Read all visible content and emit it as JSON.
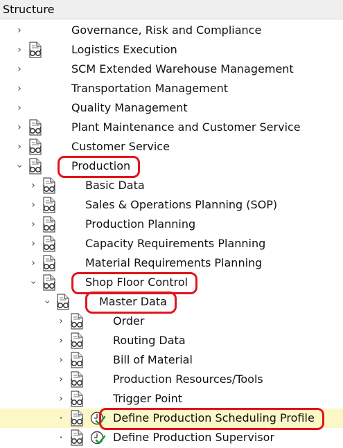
{
  "header": {
    "title": "Structure"
  },
  "tree": [
    {
      "label": "Governance, Risk and Compliance",
      "level": 0,
      "expander": "collapsed",
      "icon": "none"
    },
    {
      "label": "Logistics Execution",
      "level": 0,
      "expander": "collapsed",
      "icon": "documentation-glasses-icon"
    },
    {
      "label": "SCM Extended Warehouse Management",
      "level": 0,
      "expander": "collapsed",
      "icon": "none"
    },
    {
      "label": "Transportation Management",
      "level": 0,
      "expander": "collapsed",
      "icon": "none"
    },
    {
      "label": "Quality Management",
      "level": 0,
      "expander": "collapsed",
      "icon": "none"
    },
    {
      "label": "Plant Maintenance and Customer Service",
      "level": 0,
      "expander": "collapsed",
      "icon": "documentation-glasses-icon"
    },
    {
      "label": "Customer Service",
      "level": 0,
      "expander": "collapsed",
      "icon": "documentation-glasses-icon"
    },
    {
      "label": "Production",
      "level": 0,
      "expander": "expanded",
      "icon": "documentation-glasses-icon",
      "marked": true
    },
    {
      "label": "Basic Data",
      "level": 1,
      "expander": "collapsed",
      "icon": "documentation-glasses-icon"
    },
    {
      "label": "Sales & Operations Planning (SOP)",
      "level": 1,
      "expander": "collapsed",
      "icon": "documentation-glasses-icon"
    },
    {
      "label": "Production Planning",
      "level": 1,
      "expander": "collapsed",
      "icon": "documentation-glasses-icon"
    },
    {
      "label": "Capacity Requirements Planning",
      "level": 1,
      "expander": "collapsed",
      "icon": "documentation-glasses-icon"
    },
    {
      "label": "Material Requirements Planning",
      "level": 1,
      "expander": "collapsed",
      "icon": "documentation-glasses-icon"
    },
    {
      "label": "Shop Floor Control",
      "level": 1,
      "expander": "expanded",
      "icon": "documentation-glasses-icon",
      "marked": true
    },
    {
      "label": "Master Data",
      "level": 2,
      "expander": "expanded",
      "icon": "documentation-glasses-icon",
      "marked": true
    },
    {
      "label": "Order",
      "level": 3,
      "expander": "collapsed",
      "icon": "documentation-glasses-icon"
    },
    {
      "label": "Routing Data",
      "level": 3,
      "expander": "collapsed",
      "icon": "documentation-glasses-icon"
    },
    {
      "label": "Bill of Material",
      "level": 3,
      "expander": "collapsed",
      "icon": "documentation-glasses-icon"
    },
    {
      "label": "Production Resources/Tools",
      "level": 3,
      "expander": "collapsed",
      "icon": "documentation-glasses-icon"
    },
    {
      "label": "Trigger Point",
      "level": 3,
      "expander": "collapsed",
      "icon": "documentation-glasses-icon"
    },
    {
      "label": "Define Production Scheduling Profile",
      "level": 3,
      "expander": "leaf",
      "icon": "documentation-glasses-icon",
      "activity_icon": "execute-clock-check-icon",
      "highlighted": true,
      "marked": true
    },
    {
      "label": "Define Production Supervisor",
      "level": 3,
      "expander": "leaf",
      "icon": "documentation-glasses-icon",
      "activity_icon": "execute-clock-check-icon"
    }
  ],
  "colors": {
    "header_bg": "#efefef",
    "highlight_row": "#fbf7c6",
    "annotation_red": "#e0141b",
    "check_green": "#1a9c2c"
  }
}
